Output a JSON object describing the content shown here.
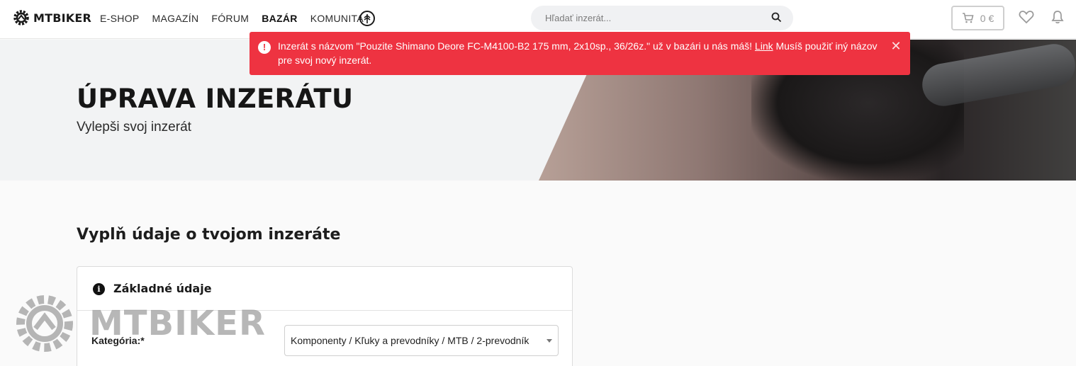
{
  "header": {
    "logo_text": "MTBIKER",
    "nav": [
      "E-SHOP",
      "MAGAZÍN",
      "FÓRUM",
      "BAZÁR",
      "KOMUNITA"
    ],
    "active_nav": "BAZÁR",
    "search_placeholder": "Hľadať inzerát...",
    "cart_value": "0 €"
  },
  "alert": {
    "text_before": "Inzerát s názvom \"Pouzite Shimano Deore FC-M4100-B2 175 mm, 2x10sp., 36/26z.\" už v bazári u nás máš! ",
    "link": "Link",
    "text_after": " Musíš použiť iný názov pre svoj nový inzerát.",
    "color": "#ee3341"
  },
  "hero": {
    "title": "ÚPRAVA INZERÁTU",
    "subtitle": "Vylepši svoj inzerát"
  },
  "main": {
    "section_title": "Vyplň údaje o tvojom inzeráte",
    "card_title": "Základné údaje",
    "category_label": "Kategória:*",
    "category_value": "Komponenty / Kľuky a prevodníky / MTB / 2-prevodník"
  },
  "watermark": {
    "text": "MTBIKER"
  }
}
